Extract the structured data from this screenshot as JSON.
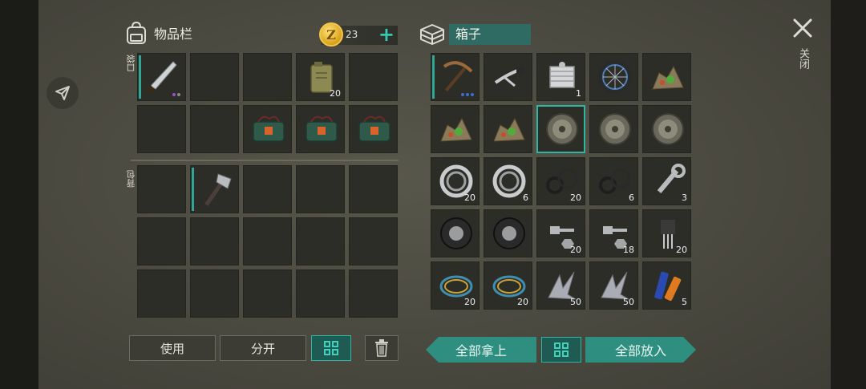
{
  "header": {
    "title": "物品栏",
    "coins": "23",
    "box_title": "箱子"
  },
  "labels": {
    "pocket": "口袋",
    "backpack": "背包",
    "close": "关闭"
  },
  "colors": {
    "accent": "#2fb6a2",
    "action": "#2e8f80",
    "coin": "#e3ad2a"
  },
  "pocket_items": [
    {
      "name": "machete",
      "count": ""
    },
    {
      "name": "empty",
      "count": ""
    },
    {
      "name": "empty",
      "count": ""
    },
    {
      "name": "jerrycan",
      "count": "20"
    },
    {
      "name": "empty",
      "count": ""
    },
    {
      "name": "empty",
      "count": ""
    },
    {
      "name": "empty",
      "count": ""
    },
    {
      "name": "explosive-pack",
      "count": ""
    },
    {
      "name": "explosive-pack",
      "count": ""
    },
    {
      "name": "explosive-pack",
      "count": ""
    }
  ],
  "backpack_items": [
    {
      "name": "empty"
    },
    {
      "name": "hatchet"
    },
    {
      "name": "empty"
    },
    {
      "name": "empty"
    },
    {
      "name": "empty"
    },
    {
      "name": "empty"
    },
    {
      "name": "empty"
    },
    {
      "name": "empty"
    },
    {
      "name": "empty"
    },
    {
      "name": "empty"
    },
    {
      "name": "empty"
    },
    {
      "name": "empty"
    },
    {
      "name": "empty"
    },
    {
      "name": "empty"
    },
    {
      "name": "empty"
    }
  ],
  "box_items": [
    {
      "name": "pickaxe",
      "count": ""
    },
    {
      "name": "handlebar",
      "count": ""
    },
    {
      "name": "engine-cylinder",
      "count": "1"
    },
    {
      "name": "bike-wheel",
      "count": ""
    },
    {
      "name": "ore-pile",
      "count": ""
    },
    {
      "name": "ore-pile",
      "count": ""
    },
    {
      "name": "ore-pile",
      "count": ""
    },
    {
      "name": "brake-drum",
      "count": ""
    },
    {
      "name": "brake-drum",
      "count": ""
    },
    {
      "name": "brake-drum",
      "count": ""
    },
    {
      "name": "bearing",
      "count": "20"
    },
    {
      "name": "bearing",
      "count": "6"
    },
    {
      "name": "gasket-set",
      "count": "20"
    },
    {
      "name": "gasket-set",
      "count": "6"
    },
    {
      "name": "wrench",
      "count": "3"
    },
    {
      "name": "tire",
      "count": ""
    },
    {
      "name": "tire",
      "count": ""
    },
    {
      "name": "bolt-nut",
      "count": "20"
    },
    {
      "name": "bolt-nut",
      "count": "18"
    },
    {
      "name": "transistor",
      "count": "20"
    },
    {
      "name": "wire-coil",
      "count": "20"
    },
    {
      "name": "wire-coil",
      "count": "20"
    },
    {
      "name": "metal-scrap",
      "count": "50"
    },
    {
      "name": "metal-scrap",
      "count": "50"
    },
    {
      "name": "batteries",
      "count": "5"
    }
  ],
  "buttons": {
    "use": "使用",
    "split": "分开",
    "take_all": "全部拿上",
    "put_all": "全部放入"
  }
}
